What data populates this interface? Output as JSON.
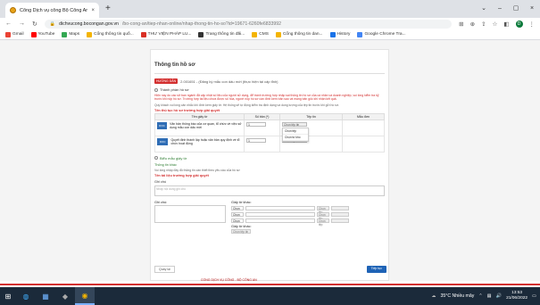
{
  "browser": {
    "tab_title": "Cổng Dịch vụ công Bộ Công An",
    "close_glyph": "×",
    "new_tab_glyph": "+",
    "url_host": "dichvucong.bocongan.gov.vn",
    "url_path": "/bo-cong-an/tiep-nhan-online/nhap-thong-tin-ho-so?id=19671-6260fe6833992",
    "window": {
      "minimize": "⌄",
      "min2": "–",
      "max": "▢",
      "close": "×"
    },
    "profile_letter": "D"
  },
  "bookmarks": [
    {
      "label": "Gmail",
      "color": "#ea4335"
    },
    {
      "label": "YouTube",
      "color": "#ff0000"
    },
    {
      "label": "Maps",
      "color": "#34a853"
    },
    {
      "label": "Cổng thông tin quố...",
      "color": "#f4b400"
    },
    {
      "label": "THƯ VIỆN PHÁP LU...",
      "color": "#d93025"
    },
    {
      "label": "Trang thông tin đăi...",
      "color": "#333333"
    },
    {
      "label": "CMS",
      "color": "#f4b400"
    },
    {
      "label": "Cổng thông tin dan...",
      "color": "#f4b400"
    },
    {
      "label": "History",
      "color": "#1a73e8"
    },
    {
      "label": "Google Chrome Tra...",
      "color": "#4285f4"
    }
  ],
  "form": {
    "section_title": "Thông tin hồ sơ",
    "badge": "HƯỚNG DẪN",
    "badge_text": "2.001651 - (Đăng ký mẫu con dấu mới (thực hiện tại cấp tỉnh)",
    "radio1": "Thành phần hồ sơ",
    "notice": "Hiện nay do các sở ban ngành đã cập nhật số liệu của người sử dụng, để tránh trường hợp nhập sai thông tin hồ sơ của cá nhân và doanh nghiệp, vui lòng kiểm tra kỹ trước khi nộp hồ sơ. Trường hợp tài liệu chưa được số hóa, người nộp hồ sơ cần đính kèm bản sao và mang bản gốc khi nhận kết quả.",
    "notice2": "Quý khách vui lòng cân nhắc khi đính kèm giấy tờ. Hệ thống sẽ tự động kiểm tra định dạng và dung lượng của tệp tin trước khi gửi hồ sơ.",
    "table_head": "Tên thủ tục hồ sơ trường hợp giải quyết",
    "col_ten": "Tên giấy tờ",
    "col_so": "Số bản (*)",
    "col_tep": "Tệp tin",
    "col_mau": "Mẫu đơn",
    "row1_text": "Văn bản thông báo của cơ quan, tổ chức về việc sử dụng mẫu con dấu mới",
    "row2_text": "Quyết định thành lập hoặc văn bản quy định về tổ chức hoạt động",
    "row1_qty": "1",
    "row2_qty": "1",
    "choose_file": "Chọn tệp tin",
    "dd1": "Chọn tệp",
    "dd2": "Chọn từ kho",
    "radio2": "Biểu mẫu giấy tờ",
    "thong_tin": "Thông tin khác",
    "thong_tin_note": "Vui lòng nhập đầy đủ thông tin cần thiết theo yêu cầu của hồ sơ",
    "ten_ho_so_label": "Tên tài liệu trường hợp giải quyết",
    "ghi_chu_label": "Ghi chú",
    "ghi_chu_placeholder": "Nhập nội dung ghi chú",
    "left_label": "Ghi chú:",
    "right_label": "Giấy tờ khác:",
    "sel_label": "Chọn",
    "choose_small": "Chọn tệp",
    "right_label2": "Giấy tờ khác:",
    "choose_small2": "Chọn tệp tin",
    "back_btn": "Quay lại",
    "next_btn": "Tiếp tục",
    "footer_text": "CỔNG DỊCH VỤ CÔNG - BỘ CÔNG AN"
  },
  "taskbar": {
    "weather": "35°C Nhiều mây",
    "time": "13:53",
    "date": "21/06/2022"
  }
}
